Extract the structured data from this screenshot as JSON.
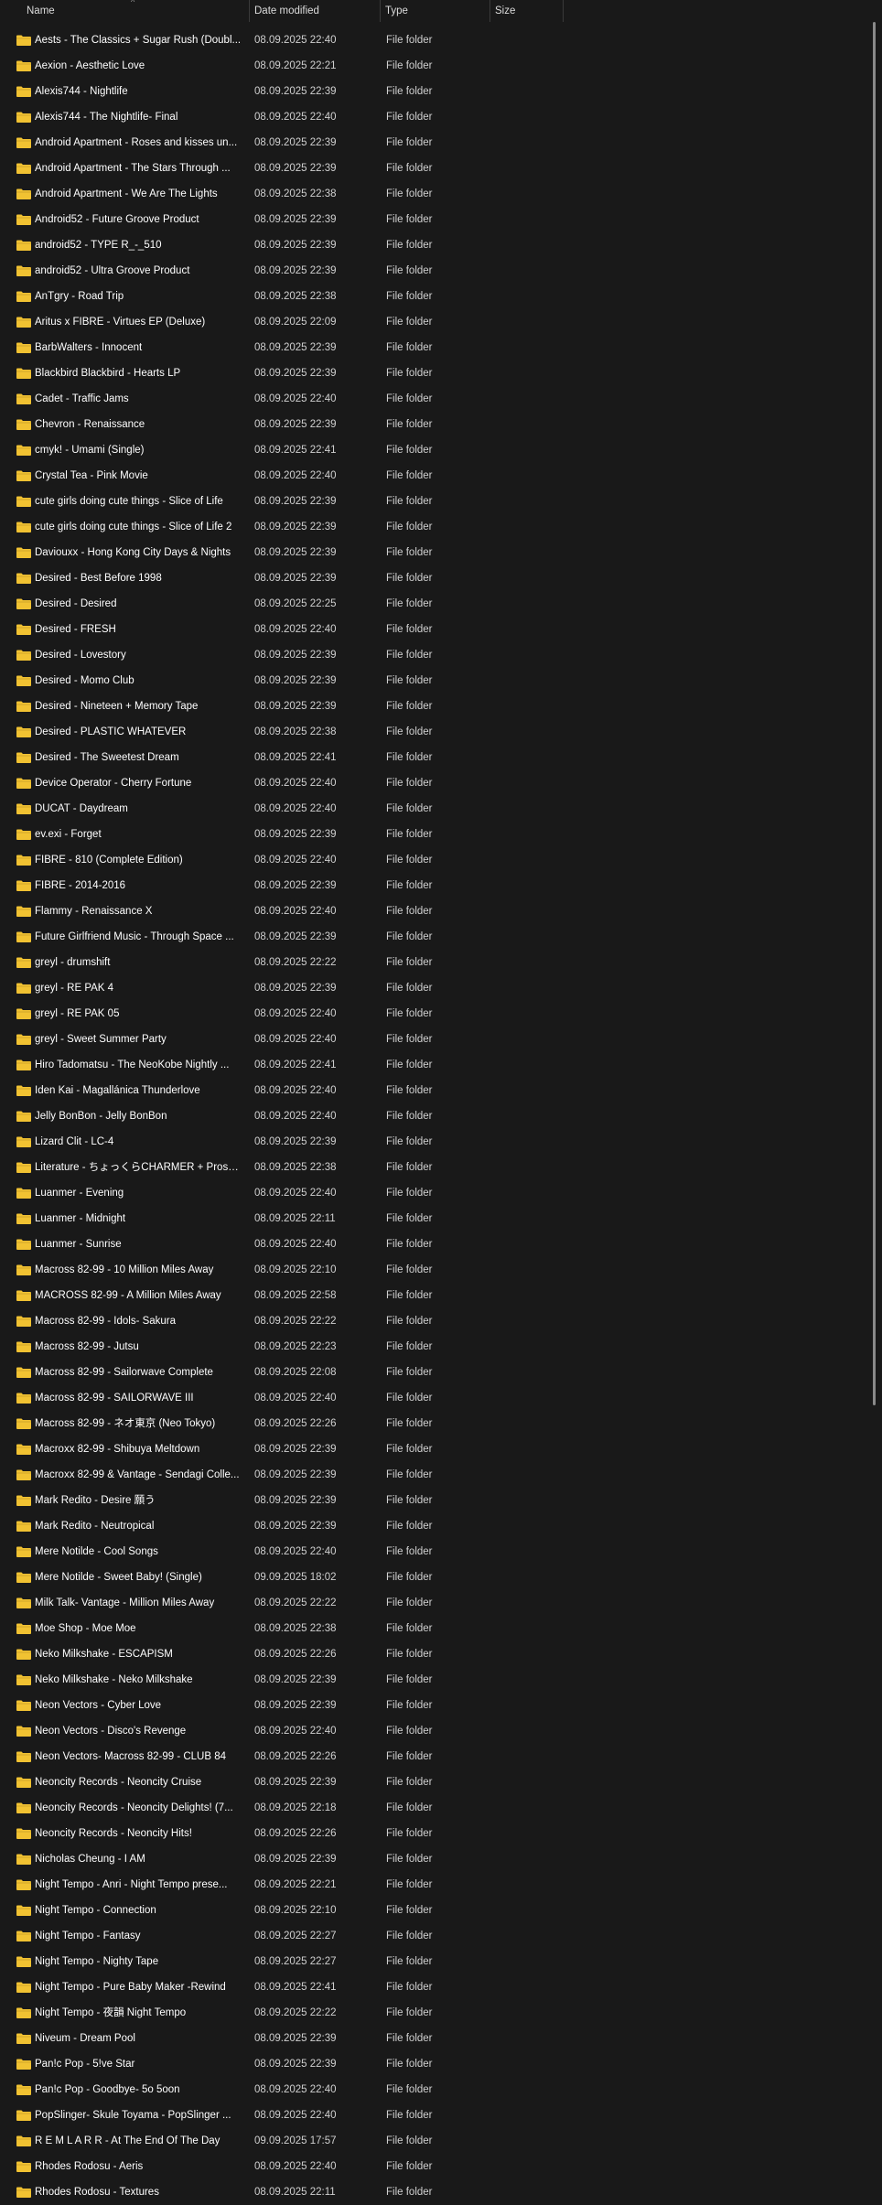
{
  "header": {
    "name": "Name",
    "date_modified": "Date modified",
    "type": "Type",
    "size": "Size",
    "sort_indicator": "^"
  },
  "icon": "folder-icon",
  "colors": {
    "background": "#191919",
    "folder": "#f1c232"
  },
  "rows": [
    {
      "name": "Aests - The Classics + Sugar Rush (Doubl...",
      "date": "08.09.2025 22:40",
      "type": "File folder"
    },
    {
      "name": "Aexion - Aesthetic Love",
      "date": "08.09.2025 22:21",
      "type": "File folder"
    },
    {
      "name": "Alexis744 - Nightlife",
      "date": "08.09.2025 22:39",
      "type": "File folder"
    },
    {
      "name": "Alexis744 - The Nightlife- Final",
      "date": "08.09.2025 22:40",
      "type": "File folder"
    },
    {
      "name": "Android Apartment - Roses and kisses un...",
      "date": "08.09.2025 22:39",
      "type": "File folder"
    },
    {
      "name": "Android Apartment - The Stars Through ...",
      "date": "08.09.2025 22:39",
      "type": "File folder"
    },
    {
      "name": "Android Apartment - We Are The Lights",
      "date": "08.09.2025 22:38",
      "type": "File folder"
    },
    {
      "name": "Android52 - Future Groove Product",
      "date": "08.09.2025 22:39",
      "type": "File folder"
    },
    {
      "name": "android52 - TYPE R_-_510",
      "date": "08.09.2025 22:39",
      "type": "File folder"
    },
    {
      "name": "android52 - Ultra Groove Product",
      "date": "08.09.2025 22:39",
      "type": "File folder"
    },
    {
      "name": "AnTgry - Road Trip",
      "date": "08.09.2025 22:38",
      "type": "File folder"
    },
    {
      "name": "Aritus x FIBRE - Virtues EP (Deluxe)",
      "date": "08.09.2025 22:09",
      "type": "File folder"
    },
    {
      "name": "BarbWalters - Innocent",
      "date": "08.09.2025 22:39",
      "type": "File folder"
    },
    {
      "name": "Blackbird Blackbird - Hearts LP",
      "date": "08.09.2025 22:39",
      "type": "File folder"
    },
    {
      "name": "Cadet - Traffic Jams",
      "date": "08.09.2025 22:40",
      "type": "File folder"
    },
    {
      "name": "Chevron - Renaissance",
      "date": "08.09.2025 22:39",
      "type": "File folder"
    },
    {
      "name": "cmyk! - Umami (Single)",
      "date": "08.09.2025 22:41",
      "type": "File folder"
    },
    {
      "name": "Crystal Tea - Pink Movie",
      "date": "08.09.2025 22:40",
      "type": "File folder"
    },
    {
      "name": "cute girls doing cute things - Slice of Life",
      "date": "08.09.2025 22:39",
      "type": "File folder"
    },
    {
      "name": "cute girls doing cute things - Slice of Life 2",
      "date": "08.09.2025 22:39",
      "type": "File folder"
    },
    {
      "name": "Daviouxx - Hong Kong City Days & Nights",
      "date": "08.09.2025 22:39",
      "type": "File folder"
    },
    {
      "name": "Desired - Best Before 1998",
      "date": "08.09.2025 22:39",
      "type": "File folder"
    },
    {
      "name": "Desired - Desired",
      "date": "08.09.2025 22:25",
      "type": "File folder"
    },
    {
      "name": "Desired - FRESH",
      "date": "08.09.2025 22:40",
      "type": "File folder"
    },
    {
      "name": "Desired - Lovestory",
      "date": "08.09.2025 22:39",
      "type": "File folder"
    },
    {
      "name": "Desired - Momo Club",
      "date": "08.09.2025 22:39",
      "type": "File folder"
    },
    {
      "name": "Desired - Nineteen + Memory Tape",
      "date": "08.09.2025 22:39",
      "type": "File folder"
    },
    {
      "name": "Desired - PLASTIC WHATEVER",
      "date": "08.09.2025 22:38",
      "type": "File folder"
    },
    {
      "name": "Desired - The Sweetest Dream",
      "date": "08.09.2025 22:41",
      "type": "File folder"
    },
    {
      "name": "Device Operator - Cherry Fortune",
      "date": "08.09.2025 22:40",
      "type": "File folder"
    },
    {
      "name": "DUCAT - Daydream",
      "date": "08.09.2025 22:40",
      "type": "File folder"
    },
    {
      "name": "ev.exi - Forget",
      "date": "08.09.2025 22:39",
      "type": "File folder"
    },
    {
      "name": "FIBRE - 810 (Complete Edition)",
      "date": "08.09.2025 22:40",
      "type": "File folder"
    },
    {
      "name": "FIBRE - 2014-2016",
      "date": "08.09.2025 22:39",
      "type": "File folder"
    },
    {
      "name": "Flammy - Renaissance X",
      "date": "08.09.2025 22:40",
      "type": "File folder"
    },
    {
      "name": "Future Girlfriend Music - Through Space ...",
      "date": "08.09.2025 22:39",
      "type": "File folder"
    },
    {
      "name": "greyl - drumshift",
      "date": "08.09.2025 22:22",
      "type": "File folder"
    },
    {
      "name": "greyl - RE PAK 4",
      "date": "08.09.2025 22:39",
      "type": "File folder"
    },
    {
      "name": "greyl - RE PAK 05",
      "date": "08.09.2025 22:40",
      "type": "File folder"
    },
    {
      "name": "greyl - Sweet Summer Party",
      "date": "08.09.2025 22:40",
      "type": "File folder"
    },
    {
      "name": "Hiro Tadomatsu - The NeoKobe Nightly ...",
      "date": "08.09.2025 22:41",
      "type": "File folder"
    },
    {
      "name": "Iden Kai - Magallánica Thunderlove",
      "date": "08.09.2025 22:40",
      "type": "File folder"
    },
    {
      "name": "Jelly BonBon - Jelly BonBon",
      "date": "08.09.2025 22:40",
      "type": "File folder"
    },
    {
      "name": "Lizard Clit - LC-4",
      "date": "08.09.2025 22:39",
      "type": "File folder"
    },
    {
      "name": "Literature - ちょっくらCHARMER + Prose ザ...",
      "date": "08.09.2025 22:38",
      "type": "File folder"
    },
    {
      "name": "Luanmer - Evening",
      "date": "08.09.2025 22:40",
      "type": "File folder"
    },
    {
      "name": "Luanmer - Midnight",
      "date": "08.09.2025 22:11",
      "type": "File folder"
    },
    {
      "name": "Luanmer - Sunrise",
      "date": "08.09.2025 22:40",
      "type": "File folder"
    },
    {
      "name": "Macross 82-99 - 10 Million Miles Away",
      "date": "08.09.2025 22:10",
      "type": "File folder"
    },
    {
      "name": "MACROSS 82-99 - A Million Miles Away",
      "date": "08.09.2025 22:58",
      "type": "File folder"
    },
    {
      "name": "Macross 82-99 - Idols- Sakura",
      "date": "08.09.2025 22:22",
      "type": "File folder"
    },
    {
      "name": "Macross 82-99 - Jutsu",
      "date": "08.09.2025 22:23",
      "type": "File folder"
    },
    {
      "name": "Macross 82-99 - Sailorwave Complete",
      "date": "08.09.2025 22:08",
      "type": "File folder"
    },
    {
      "name": "Macross 82-99 - SAILORWAVE III",
      "date": "08.09.2025 22:40",
      "type": "File folder"
    },
    {
      "name": "Macross 82-99 - ネオ東京 (Neo Tokyo)",
      "date": "08.09.2025 22:26",
      "type": "File folder"
    },
    {
      "name": "Macroxx 82-99 - Shibuya Meltdown",
      "date": "08.09.2025 22:39",
      "type": "File folder"
    },
    {
      "name": "Macroxx 82-99 & Vantage - Sendagi Colle...",
      "date": "08.09.2025 22:39",
      "type": "File folder"
    },
    {
      "name": "Mark Redito - Desire 願う",
      "date": "08.09.2025 22:39",
      "type": "File folder"
    },
    {
      "name": "Mark Redito - Neutropical",
      "date": "08.09.2025 22:39",
      "type": "File folder"
    },
    {
      "name": "Mere Notilde - Cool Songs",
      "date": "08.09.2025 22:40",
      "type": "File folder"
    },
    {
      "name": "Mere Notilde - Sweet Baby! (Single)",
      "date": "09.09.2025 18:02",
      "type": "File folder"
    },
    {
      "name": "Milk Talk- Vantage - Million Miles Away",
      "date": "08.09.2025 22:22",
      "type": "File folder"
    },
    {
      "name": "Moe Shop - Moe Moe",
      "date": "08.09.2025 22:38",
      "type": "File folder"
    },
    {
      "name": "Neko Milkshake - ESCAPISM",
      "date": "08.09.2025 22:26",
      "type": "File folder"
    },
    {
      "name": "Neko Milkshake - Neko Milkshake",
      "date": "08.09.2025 22:39",
      "type": "File folder"
    },
    {
      "name": "Neon Vectors - Cyber Love",
      "date": "08.09.2025 22:39",
      "type": "File folder"
    },
    {
      "name": "Neon Vectors - Disco's Revenge",
      "date": "08.09.2025 22:40",
      "type": "File folder"
    },
    {
      "name": "Neon Vectors- Macross 82-99 - CLUB 84",
      "date": "08.09.2025 22:26",
      "type": "File folder"
    },
    {
      "name": "Neoncity Records - Neoncity Cruise",
      "date": "08.09.2025 22:39",
      "type": "File folder"
    },
    {
      "name": "Neoncity Records - Neoncity Delights! (7...",
      "date": "08.09.2025 22:18",
      "type": "File folder"
    },
    {
      "name": "Neoncity Records - Neoncity Hits!",
      "date": "08.09.2025 22:26",
      "type": "File folder"
    },
    {
      "name": "Nicholas Cheung - I AM",
      "date": "08.09.2025 22:39",
      "type": "File folder"
    },
    {
      "name": "Night Tempo - Anri - Night Tempo prese...",
      "date": "08.09.2025 22:21",
      "type": "File folder"
    },
    {
      "name": "Night Tempo - Connection",
      "date": "08.09.2025 22:10",
      "type": "File folder"
    },
    {
      "name": "Night Tempo - Fantasy",
      "date": "08.09.2025 22:27",
      "type": "File folder"
    },
    {
      "name": "Night Tempo - Nighty Tape",
      "date": "08.09.2025 22:27",
      "type": "File folder"
    },
    {
      "name": "Night Tempo - Pure Baby Maker -Rewind",
      "date": "08.09.2025 22:41",
      "type": "File folder"
    },
    {
      "name": "Night Tempo - 夜韻 Night Tempo",
      "date": "08.09.2025 22:22",
      "type": "File folder"
    },
    {
      "name": "Niveum - Dream Pool",
      "date": "08.09.2025 22:39",
      "type": "File folder"
    },
    {
      "name": "Pan!c Pop - 5!ve Star",
      "date": "08.09.2025 22:39",
      "type": "File folder"
    },
    {
      "name": "Pan!c Pop - Goodbye- 5o 5oon",
      "date": "08.09.2025 22:40",
      "type": "File folder"
    },
    {
      "name": "PopSlinger- Skule Toyama - PopSlinger ...",
      "date": "08.09.2025 22:40",
      "type": "File folder"
    },
    {
      "name": "R E M L A R R - At The End Of The Day",
      "date": "09.09.2025 17:57",
      "type": "File folder"
    },
    {
      "name": "Rhodes Rodosu - Aeris",
      "date": "08.09.2025 22:40",
      "type": "File folder"
    },
    {
      "name": "Rhodes Rodosu - Textures",
      "date": "08.09.2025 22:11",
      "type": "File folder"
    }
  ]
}
